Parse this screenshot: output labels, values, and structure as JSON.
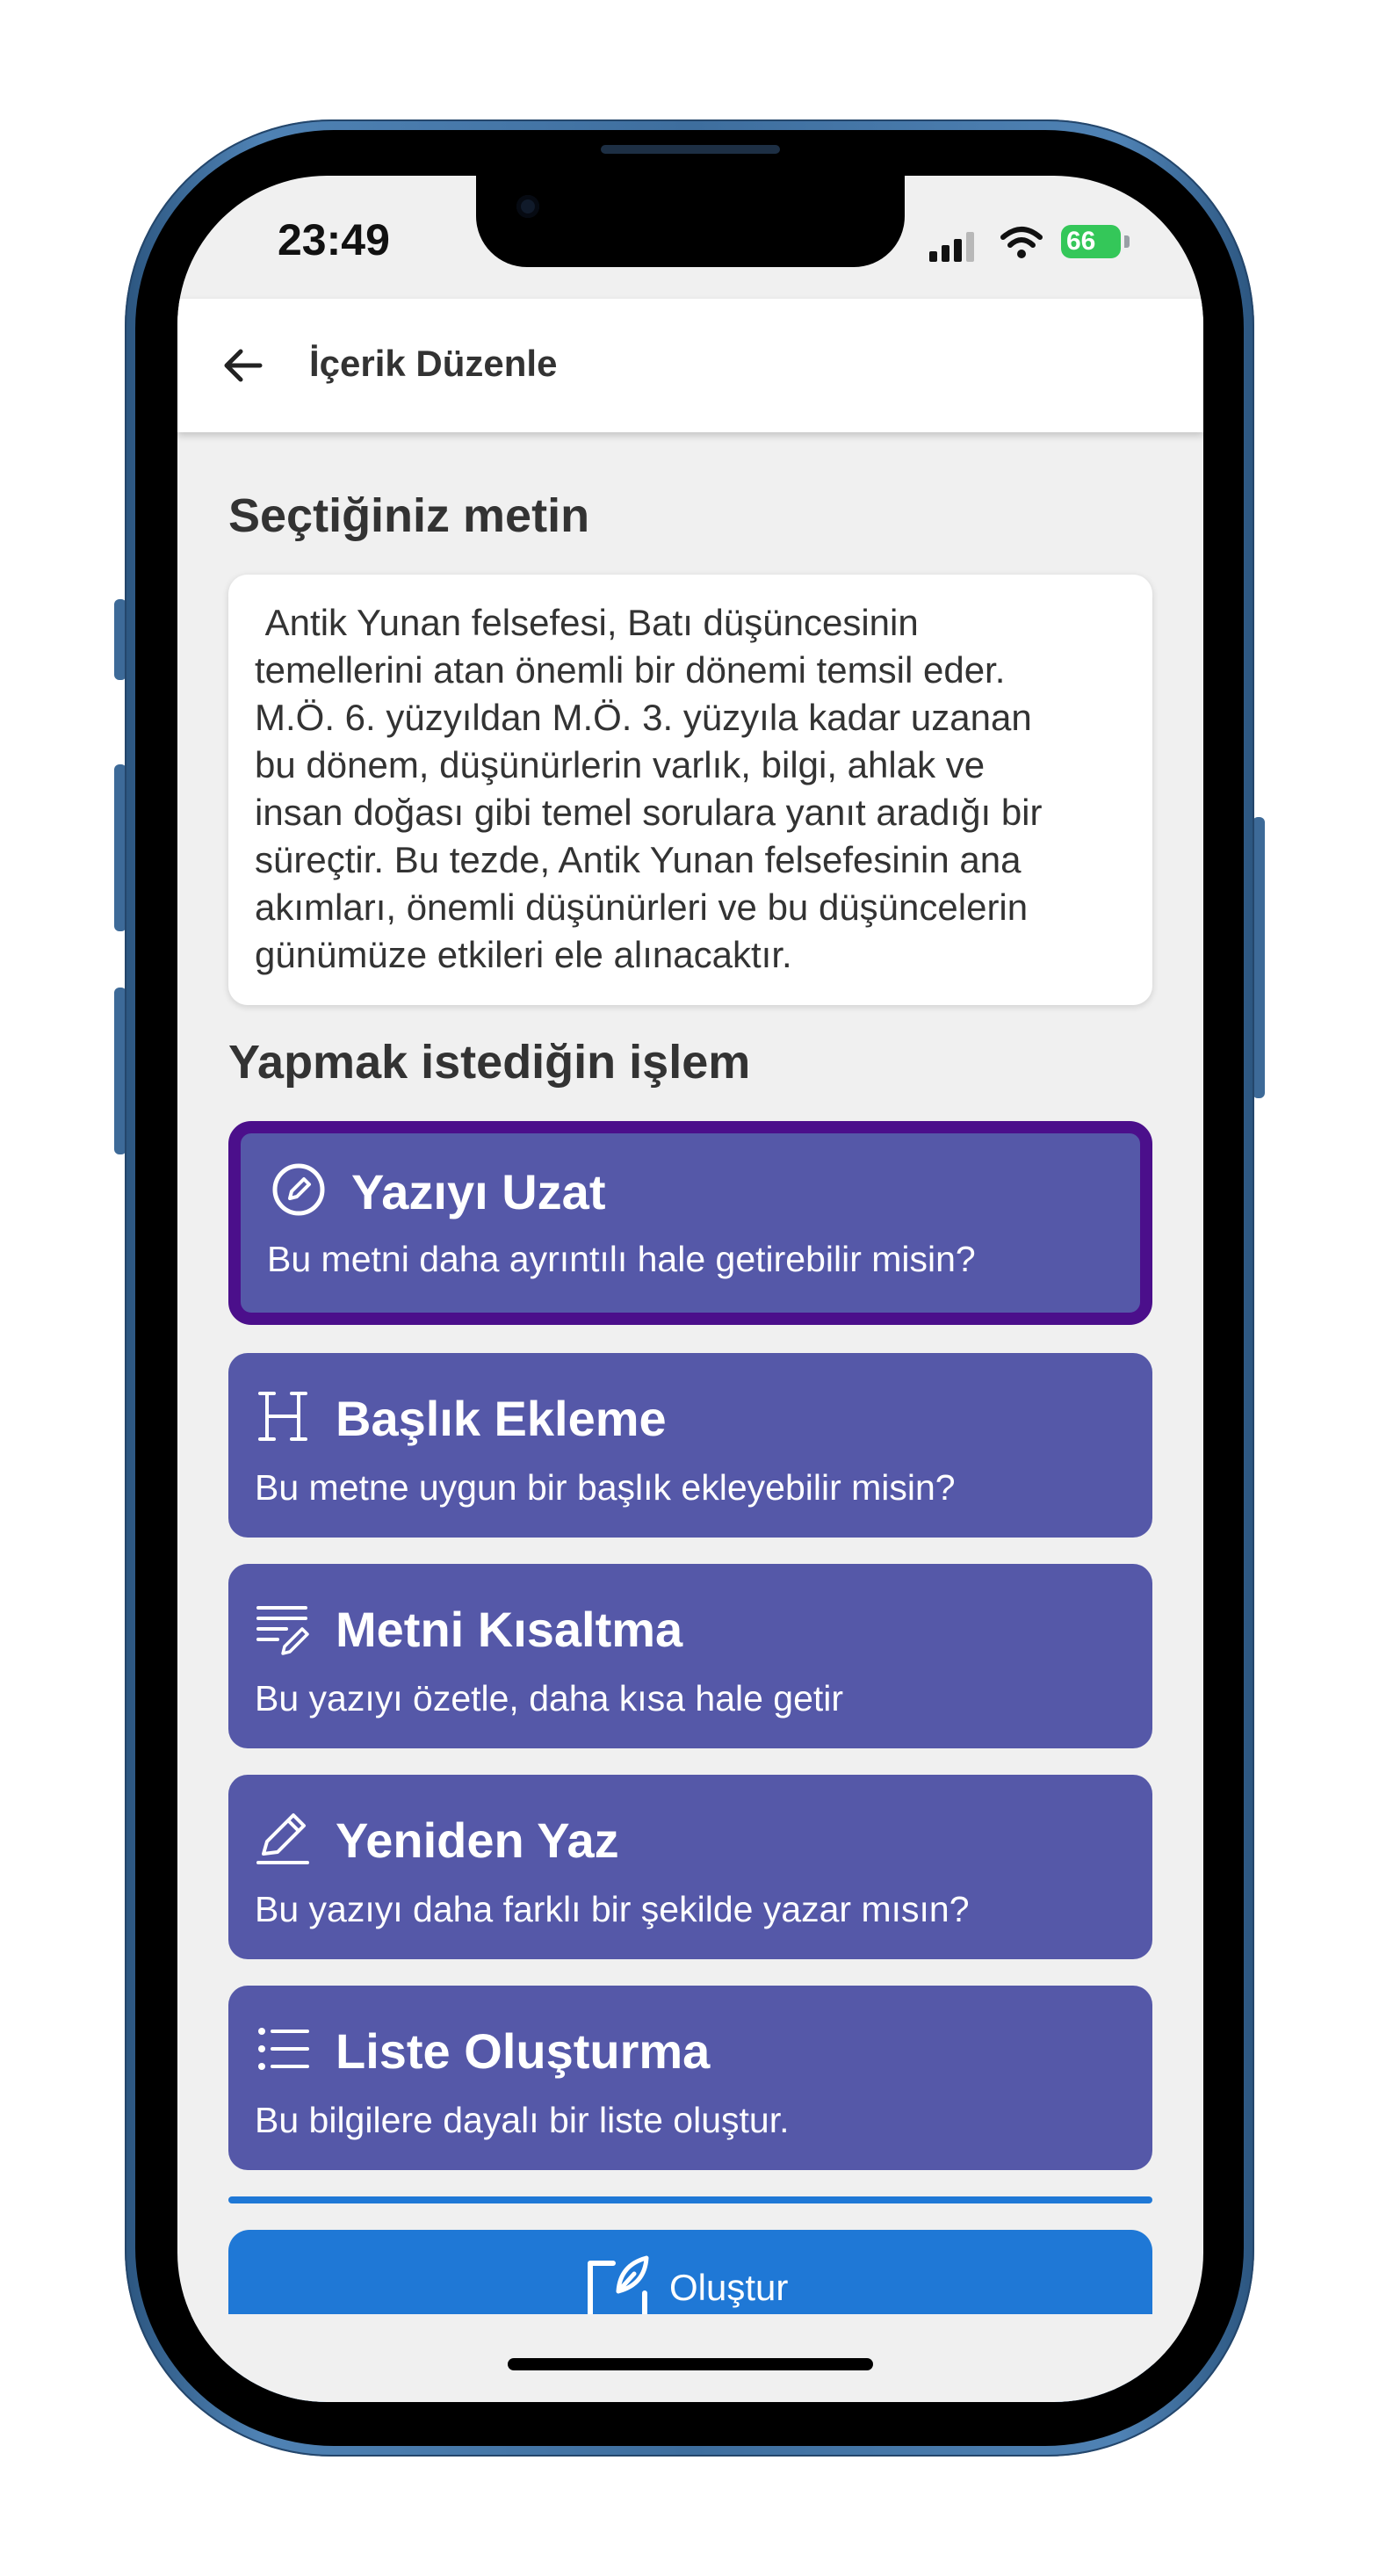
{
  "status_bar": {
    "time": "23:49",
    "battery": "66"
  },
  "app_bar": {
    "back_icon": "arrow-left-icon",
    "title": "İçerik Düzenle"
  },
  "selected_text": {
    "heading": "Seçtiğiniz metin",
    "body": " Antik Yunan felsefesi, Batı düşüncesinin\ntemellerini atan önemli bir dönemi temsil eder.\nM.Ö. 6. yüzyıldan M.Ö. 3. yüzyıla kadar uzanan\nbu dönem, düşünürlerin varlık, bilgi, ahlak ve\ninsan doğası gibi temel sorulara yanıt aradığı bir\nsüreçtir. Bu tezde, Antik Yunan felsefesinin ana\nakımları, önemli düşünürleri ve bu düşüncelerin\ngünümüze etkileri ele alınacaktır."
  },
  "actions": {
    "heading": "Yapmak istediğin işlem",
    "options": [
      {
        "title": "Yazıyı Uzat",
        "description": "Bu metni daha ayrıntılı hale getirebilir misin?",
        "icon": "expand-pen-circle-icon",
        "selected": true
      },
      {
        "title": "Başlık Ekleme",
        "description": "Bu metne uygun bir başlık ekleyebilir misin?",
        "icon": "heading-icon",
        "selected": false
      },
      {
        "title": "Metni Kısaltma",
        "description": "Bu yazıyı özetle, daha kısa hale getir",
        "icon": "text-shorten-icon",
        "selected": false
      },
      {
        "title": "Yeniden Yaz",
        "description": "Bu yazıyı daha farklı bir şekilde yazar mısın?",
        "icon": "pencil-icon",
        "selected": false
      },
      {
        "title": "Liste Oluşturma",
        "description": "Bu bilgilere dayalı bir liste oluştur.",
        "icon": "list-icon",
        "selected": false
      }
    ]
  },
  "create_button": {
    "label": "Oluştur",
    "icon": "create-edit-icon"
  },
  "colors": {
    "option_bg": "#5558a8",
    "option_selected_border": "#4b0f8b",
    "primary_blue": "#1f78d6",
    "screen_bg": "#f0f0f0"
  }
}
